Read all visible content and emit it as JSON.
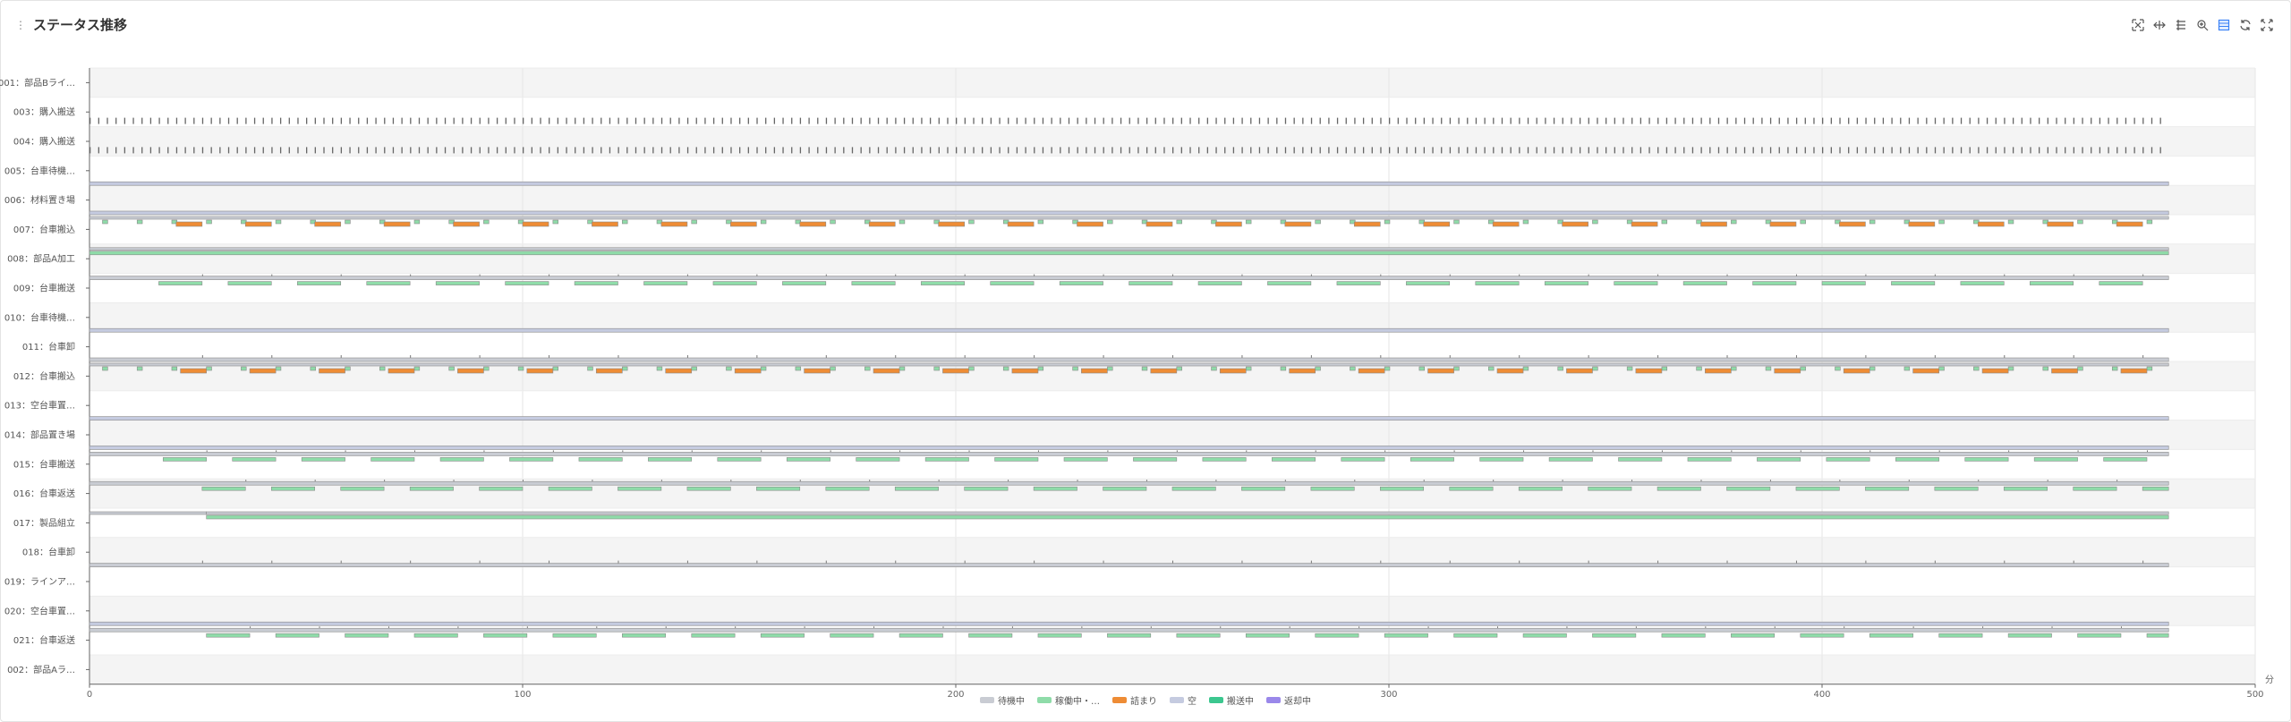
{
  "header": {
    "title": "ステータス推移",
    "toolbar": [
      "zoom-window-icon",
      "zoom-select-icon",
      "list-icon",
      "zoom-in-icon",
      "table-icon",
      "refresh-icon",
      "fullscreen-icon"
    ]
  },
  "colors": {
    "待機中": "#c9ccd3",
    "稼働中": "#8fdca9",
    "詰まり": "#ee8c35",
    "空": "#c5cbe0",
    "搬送中": "#3cc78f",
    "返却中": "#9a88ea",
    "border": "#8a8a8a",
    "grid": "#e6e6e6",
    "band": "#f4f4f4"
  },
  "chart_data": {
    "type": "gantt",
    "title": "ステータス推移",
    "xlabel": "分",
    "xlim": [
      0,
      500
    ],
    "xticks": [
      0,
      100,
      200,
      300,
      400,
      500
    ],
    "grid": true,
    "legend_position": "bottom",
    "legend": [
      {
        "name": "待機中",
        "color": "#c9ccd3"
      },
      {
        "name": "稼働中・…",
        "color": "#8fdca9"
      },
      {
        "name": "詰まり",
        "color": "#ee8c35"
      },
      {
        "name": "空",
        "color": "#c5cbe0"
      },
      {
        "name": "搬送中",
        "color": "#3cc78f"
      },
      {
        "name": "返却中",
        "color": "#9a88ea"
      }
    ],
    "rows": [
      {
        "label": "001：部品Bライ…",
        "pattern": "none"
      },
      {
        "label": "003：購入搬送",
        "pattern": "ticks"
      },
      {
        "label": "004：購入搬送",
        "pattern": "ticks"
      },
      {
        "label": "005：台車待機…",
        "pattern": "idle_lavender"
      },
      {
        "label": "006：材料置き場",
        "pattern": "idle_lavender"
      },
      {
        "label": "007：台車搬込",
        "pattern": "jam_cycle",
        "period": 16,
        "phase": 20
      },
      {
        "label": "008：部品A加工",
        "pattern": "running_full",
        "start": 0
      },
      {
        "label": "009：台車搬送",
        "pattern": "transport",
        "period": 16,
        "phase": 16
      },
      {
        "label": "010：台車待機…",
        "pattern": "idle_lavender"
      },
      {
        "label": "011：台車卸",
        "pattern": "idle_ticks"
      },
      {
        "label": "012：台車搬込",
        "pattern": "jam_cycle",
        "period": 16,
        "phase": 21
      },
      {
        "label": "013：空台車置…",
        "pattern": "idle_lavender"
      },
      {
        "label": "014：部品置き場",
        "pattern": "idle_lavender"
      },
      {
        "label": "015：台車搬送",
        "pattern": "transport",
        "period": 16,
        "phase": 17
      },
      {
        "label": "016：台車返送",
        "pattern": "transport",
        "period": 16,
        "phase": 26
      },
      {
        "label": "017：製品組立",
        "pattern": "running_full",
        "start": 27
      },
      {
        "label": "018：台車卸",
        "pattern": "idle_ticks"
      },
      {
        "label": "019：ラインア…",
        "pattern": "none"
      },
      {
        "label": "020：空台車置…",
        "pattern": "idle_lavender"
      },
      {
        "label": "021：台車返送",
        "pattern": "transport",
        "period": 16,
        "phase": 27
      },
      {
        "label": "002：部品Aラ…",
        "pattern": "none"
      }
    ]
  }
}
